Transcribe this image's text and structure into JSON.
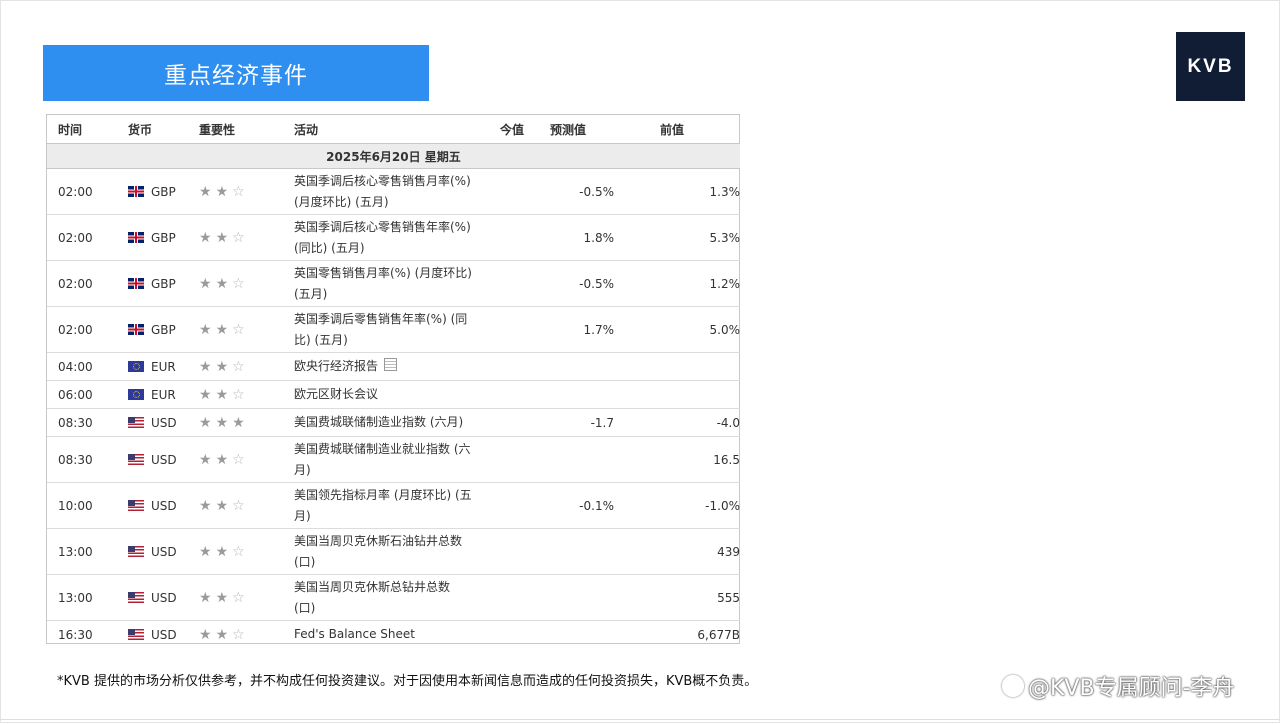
{
  "banner": {
    "title": "重点经济事件"
  },
  "logo": {
    "text": "KVB"
  },
  "table": {
    "headers": [
      "时间",
      "货币",
      "重要性",
      "活动",
      "今值",
      "预测值",
      "前值"
    ],
    "date": "2025年6月20日  星期五",
    "rows": [
      {
        "time": "02:00",
        "currency": "GBP",
        "flag": "uk-flag-icon",
        "stars": 2,
        "event": "英国季调后核心零售销售月率(%)\n(月度环比) (五月)",
        "actual": "",
        "forecast": "-0.5%",
        "previous": "1.3%"
      },
      {
        "time": "02:00",
        "currency": "GBP",
        "flag": "uk-flag-icon",
        "stars": 2,
        "event": "英国季调后核心零售销售年率(%)\n(同比) (五月)",
        "actual": "",
        "forecast": "1.8%",
        "previous": "5.3%"
      },
      {
        "time": "02:00",
        "currency": "GBP",
        "flag": "uk-flag-icon",
        "stars": 2,
        "event": "英国零售销售月率(%) (月度环比)\n(五月)",
        "actual": "",
        "forecast": "-0.5%",
        "previous": "1.2%"
      },
      {
        "time": "02:00",
        "currency": "GBP",
        "flag": "uk-flag-icon",
        "stars": 2,
        "event": "英国季调后零售销售年率(%) (同\n比) (五月)",
        "actual": "",
        "forecast": "1.7%",
        "previous": "5.0%"
      },
      {
        "time": "04:00",
        "currency": "EUR",
        "flag": "eu-flag-icon",
        "stars": 2,
        "event": "欧央行经济报告",
        "report_icon": true,
        "actual": "",
        "forecast": "",
        "previous": ""
      },
      {
        "time": "06:00",
        "currency": "EUR",
        "flag": "eu-flag-icon",
        "stars": 2,
        "event": "欧元区财长会议",
        "actual": "",
        "forecast": "",
        "previous": ""
      },
      {
        "time": "08:30",
        "currency": "USD",
        "flag": "us-flag-icon",
        "stars": 3,
        "event": "美国费城联储制造业指数 (六月)",
        "actual": "",
        "forecast": "-1.7",
        "previous": "-4.0"
      },
      {
        "time": "08:30",
        "currency": "USD",
        "flag": "us-flag-icon",
        "stars": 2,
        "event": "美国费城联储制造业就业指数 (六\n月)",
        "actual": "",
        "forecast": "",
        "previous": "16.5"
      },
      {
        "time": "10:00",
        "currency": "USD",
        "flag": "us-flag-icon",
        "stars": 2,
        "event": "美国领先指标月率 (月度环比) (五\n月)",
        "actual": "",
        "forecast": "-0.1%",
        "previous": "-1.0%"
      },
      {
        "time": "13:00",
        "currency": "USD",
        "flag": "us-flag-icon",
        "stars": 2,
        "event": "美国当周贝克休斯石油钻井总数\n(口)",
        "actual": "",
        "forecast": "",
        "previous": "439"
      },
      {
        "time": "13:00",
        "currency": "USD",
        "flag": "us-flag-icon",
        "stars": 2,
        "event": "美国当周贝克休斯总钻井总数\n(口)",
        "actual": "",
        "forecast": "",
        "previous": "555"
      },
      {
        "time": "16:30",
        "currency": "USD",
        "flag": "us-flag-icon",
        "stars": 2,
        "event": "Fed's Balance Sheet",
        "actual": "",
        "forecast": "",
        "previous": "6,677B"
      }
    ]
  },
  "disclaimer": "*KVB 提供的市场分析仅供参考，并不构成任何投资建议。对于因使用本新闻信息而造成的任何投资损失，KVB概不负责。",
  "watermark": "@KVB专属顾问-李舟"
}
